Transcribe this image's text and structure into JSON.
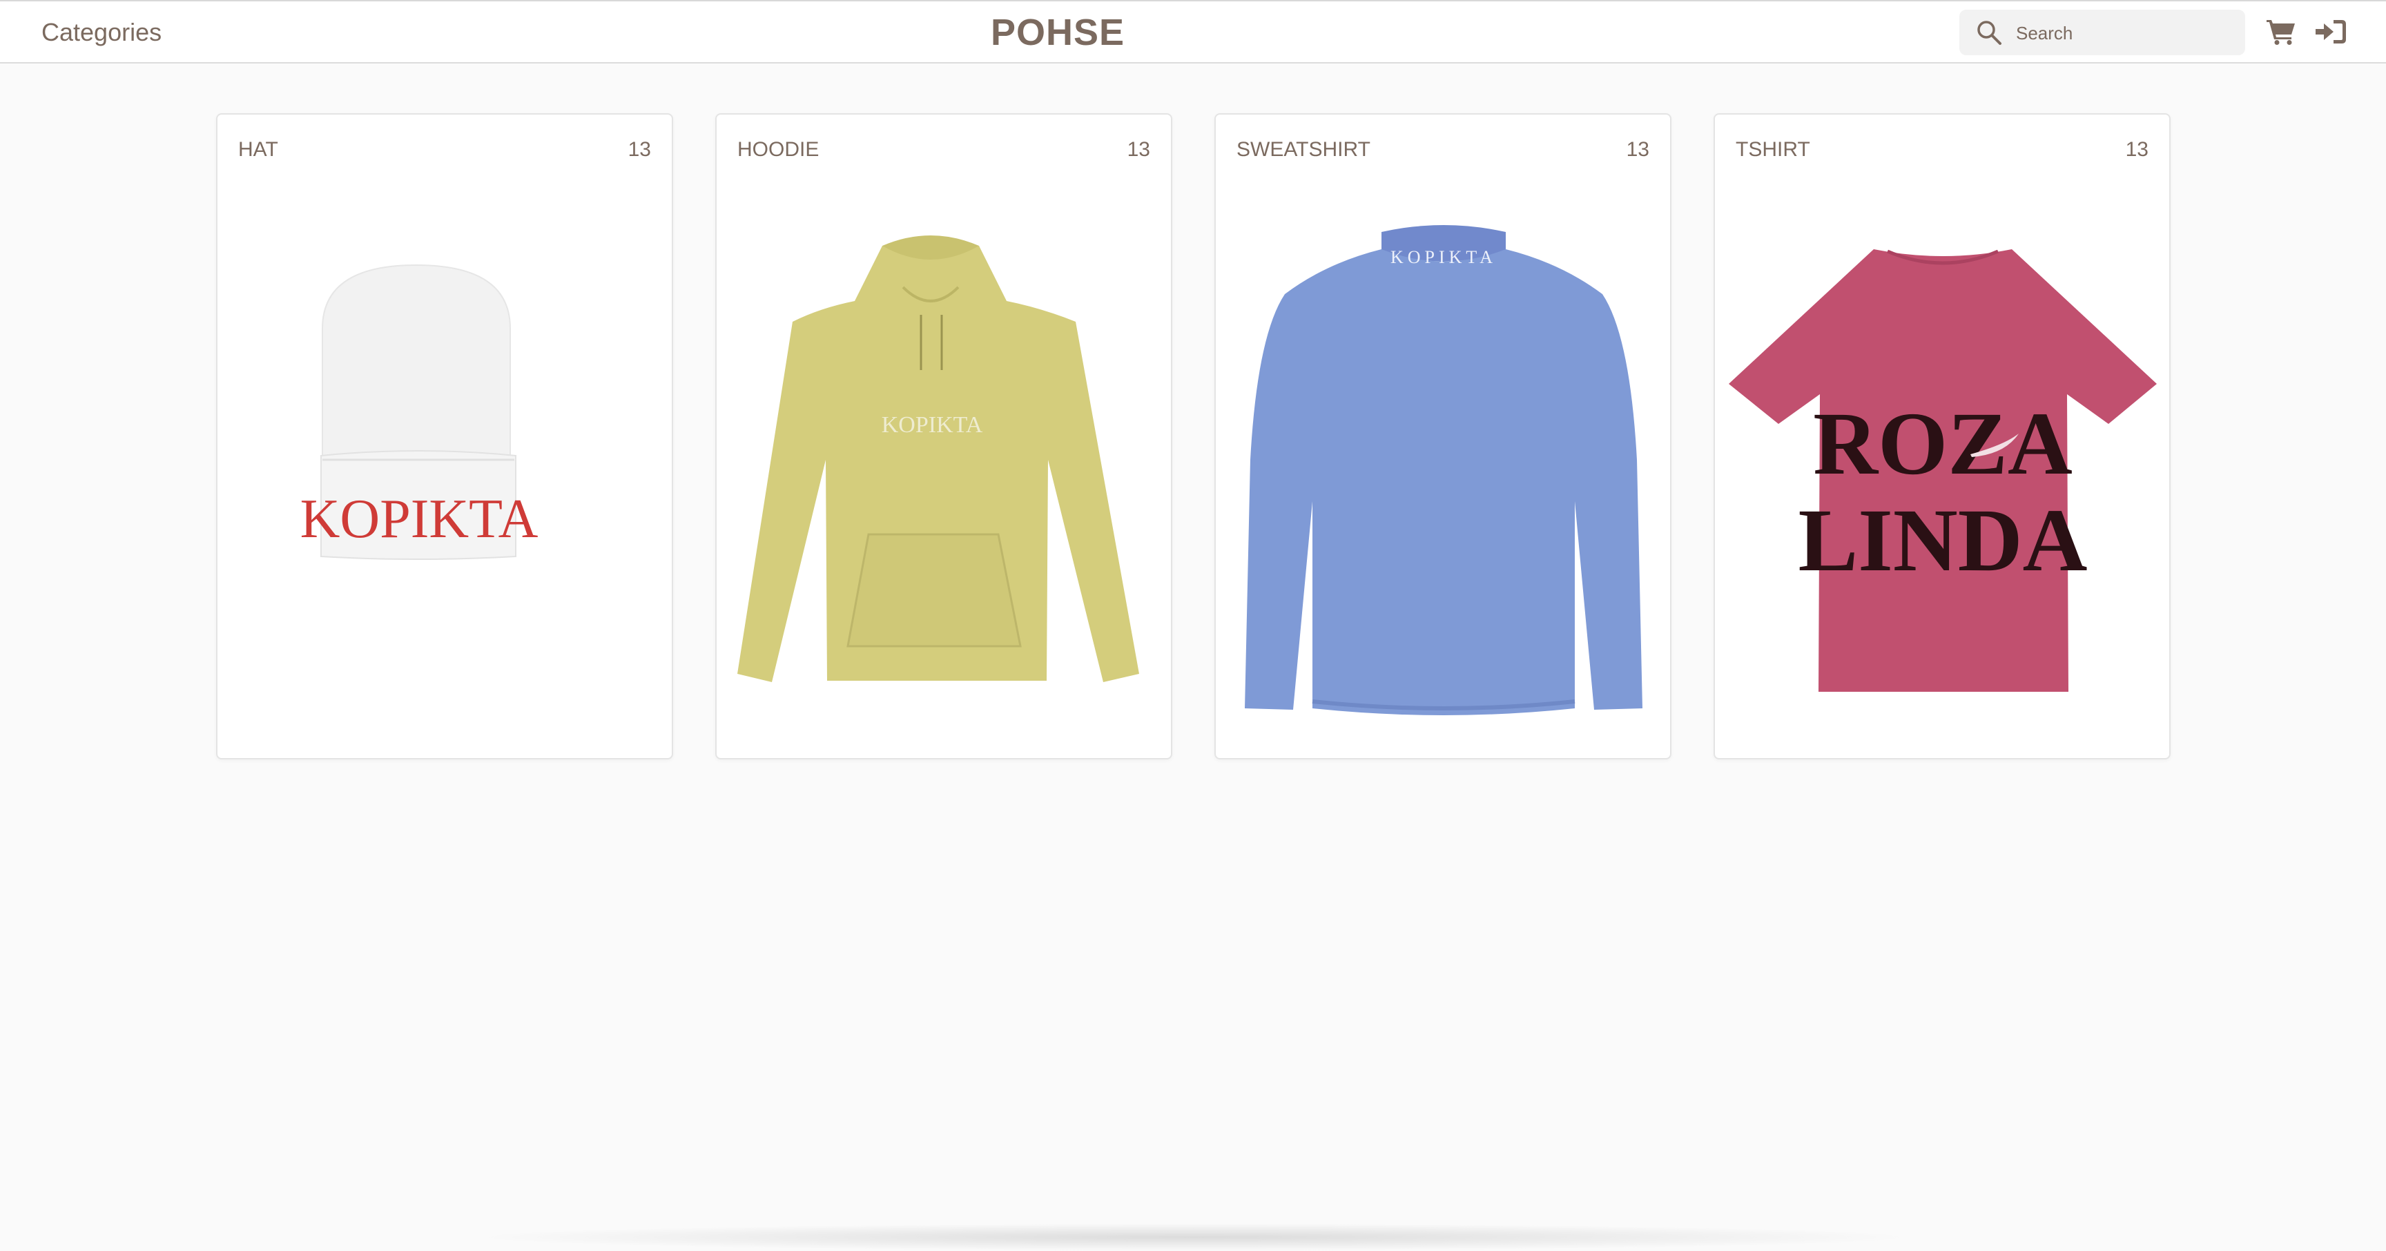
{
  "header": {
    "categories_label": "Categories",
    "brand": "POHSE",
    "search_placeholder": "Search",
    "icons": [
      "search-icon",
      "cart-icon",
      "login-icon"
    ]
  },
  "categories": [
    {
      "name": "HAT",
      "count": "13",
      "print": "KOPIKTA",
      "color": "#f3f3f3"
    },
    {
      "name": "HOODIE",
      "count": "13",
      "print": "KOPIKTA",
      "color": "#d4cd7c"
    },
    {
      "name": "SWEATSHIRT",
      "count": "13",
      "print": "KOPIKTA",
      "color": "#7f9ad6"
    },
    {
      "name": "TSHIRT",
      "count": "13",
      "print": "ROZA LINDA",
      "color": "#c1506f"
    }
  ],
  "colors": {
    "text": "#7b6a5f",
    "background": "#fafafa",
    "hat_print": "#cf3b37"
  }
}
